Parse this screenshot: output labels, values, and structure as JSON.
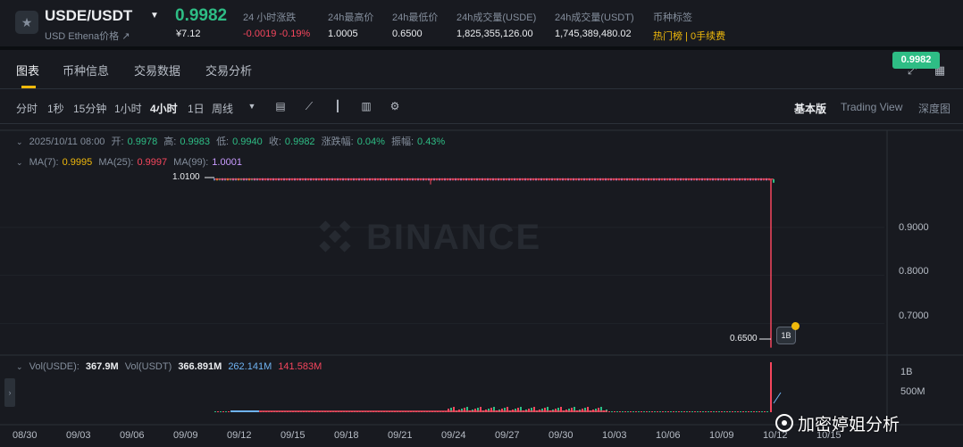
{
  "ticker": {
    "symbol": "USDE/USDT",
    "subtitle": "USD Ethena价格 ↗",
    "price": "0.9982",
    "price_cny": "¥7.12",
    "change_label": "24 小时涨跌",
    "change_value": "-0.0019 -0.19%",
    "high_label": "24h最高价",
    "high_value": "1.0005",
    "low_label": "24h最低价",
    "low_value": "0.6500",
    "vol_base_label": "24h成交量(USDE)",
    "vol_base_value": "1,825,355,126.00",
    "vol_quote_label": "24h成交量(USDT)",
    "vol_quote_value": "1,745,389,480.02",
    "tags_label": "币种标签",
    "tags_value": "热门榜 | 0手续费"
  },
  "tabs": [
    "图表",
    "币种信息",
    "交易数据",
    "交易分析"
  ],
  "intervals": [
    "分时",
    "1秒",
    "15分钟",
    "1小时",
    "4小时",
    "1日",
    "周线"
  ],
  "active_interval": "4小时",
  "versions": [
    "基本版",
    "Trading View",
    "深度图"
  ],
  "ohlc": {
    "datetime": "2025/10/11 08:00",
    "open_label": "开:",
    "open": "0.9978",
    "high_label": "高:",
    "high": "0.9983",
    "low_label": "低:",
    "low": "0.9940",
    "close_label": "收:",
    "close": "0.9982",
    "chg_label": "涨跌幅:",
    "chg": "0.04%",
    "amp_label": "振幅:",
    "amp": "0.43%"
  },
  "ma": {
    "ma7_label": "MA(7):",
    "ma7": "0.9995",
    "ma25_label": "MA(25):",
    "ma25": "0.9997",
    "ma99_label": "MA(99):",
    "ma99": "1.0001"
  },
  "volume": {
    "base_label": "Vol(USDE):",
    "base": "367.9M",
    "quote_label": "Vol(USDT)",
    "quote": "366.891M",
    "ma1": "262.141M",
    "ma2": "141.583M",
    "axis": [
      "1B",
      "500M"
    ]
  },
  "watermark": "BINANCE",
  "credit": "加密婷姐分析",
  "colors": {
    "up": "#2ebd85",
    "down": "#f6465d",
    "accent": "#f0b90b",
    "bg": "#181a20"
  },
  "chart_data": {
    "type": "line",
    "title": "",
    "xlabel": "",
    "ylabel": "",
    "x": [
      "08/30",
      "09/03",
      "09/06",
      "09/09",
      "09/12",
      "09/15",
      "09/18",
      "09/21",
      "09/24",
      "09/27",
      "09/30",
      "10/03",
      "10/06",
      "10/09",
      "10/11",
      "10/12"
    ],
    "series": [
      {
        "values": [
          null,
          null,
          null,
          null,
          1.0,
          1.0,
          1.0,
          1.0,
          1.0,
          1.0,
          1.0,
          1.0,
          1.0,
          1.0,
          0.65,
          0.9982
        ]
      }
    ],
    "y_ticks": [
      "0.7000",
      "0.8000",
      "0.9000"
    ],
    "x_ticks": [
      "08/30",
      "09/03",
      "09/06",
      "09/09",
      "09/12",
      "09/15",
      "09/18",
      "09/21",
      "09/24",
      "09/27",
      "09/30",
      "10/03",
      "10/06",
      "10/09",
      "10/12",
      "10/15"
    ],
    "last_price": "0.9982",
    "max_label": "1.0100",
    "min_label": "0.6500",
    "ylim": [
      0.64,
      1.02
    ]
  }
}
